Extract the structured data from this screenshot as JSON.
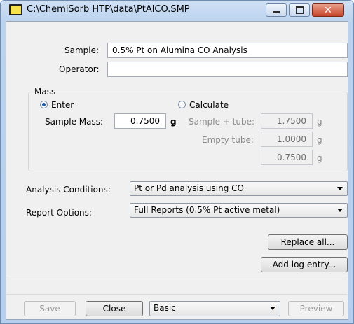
{
  "window": {
    "title": "C:\\ChemiSorb HTP\\data\\PtAlCO.SMP"
  },
  "form": {
    "sample_label": "Sample:",
    "sample_value": "0.5% Pt on Alumina CO Analysis",
    "operator_label": "Operator:",
    "operator_value": ""
  },
  "mass": {
    "group_label": "Mass",
    "enter_label": "Enter",
    "calculate_label": "Calculate",
    "selected": "Enter",
    "sample_mass_label": "Sample Mass:",
    "sample_mass_value": "0.7500",
    "unit": "g",
    "sample_tube_label": "Sample + tube:",
    "sample_tube_value": "1.7500",
    "empty_tube_label": "Empty tube:",
    "empty_tube_value": "1.0000",
    "computed_value": "0.7500"
  },
  "conditions": {
    "analysis_label": "Analysis Conditions:",
    "analysis_value": "Pt or Pd analysis using CO",
    "report_label": "Report Options:",
    "report_value": "Full Reports (0.5% Pt active metal)"
  },
  "actions": {
    "replace_all": "Replace all...",
    "add_log": "Add log entry..."
  },
  "footer": {
    "save": "Save",
    "close": "Close",
    "mode_value": "Basic",
    "preview": "Preview"
  }
}
